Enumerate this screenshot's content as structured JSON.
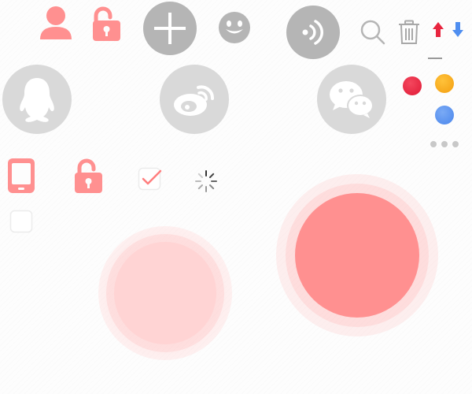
{
  "colors": {
    "accent_pink": "#ff9090",
    "light_pink": "#ffd0d0",
    "gray_circle": "#b5b5b5",
    "light_gray_circle": "#d9d9d9",
    "red_dot": "#e8253f",
    "orange_dot": "#f6aa18",
    "blue_dot": "#4f8ef0",
    "arrow_red": "#e8253f",
    "arrow_blue": "#4f8ef0",
    "line_gray": "#9a9a9a"
  },
  "icons": [
    "user-icon",
    "unlock-icon",
    "plus-icon",
    "smiley-icon",
    "sound-icon",
    "search-icon",
    "trash-icon",
    "arrow-up-icon",
    "arrow-down-icon",
    "qq-icon",
    "weibo-icon",
    "wechat-icon",
    "phone-icon",
    "checkbox-checked-icon",
    "checkbox-empty-icon",
    "spinner-icon",
    "more-dots-icon"
  ]
}
